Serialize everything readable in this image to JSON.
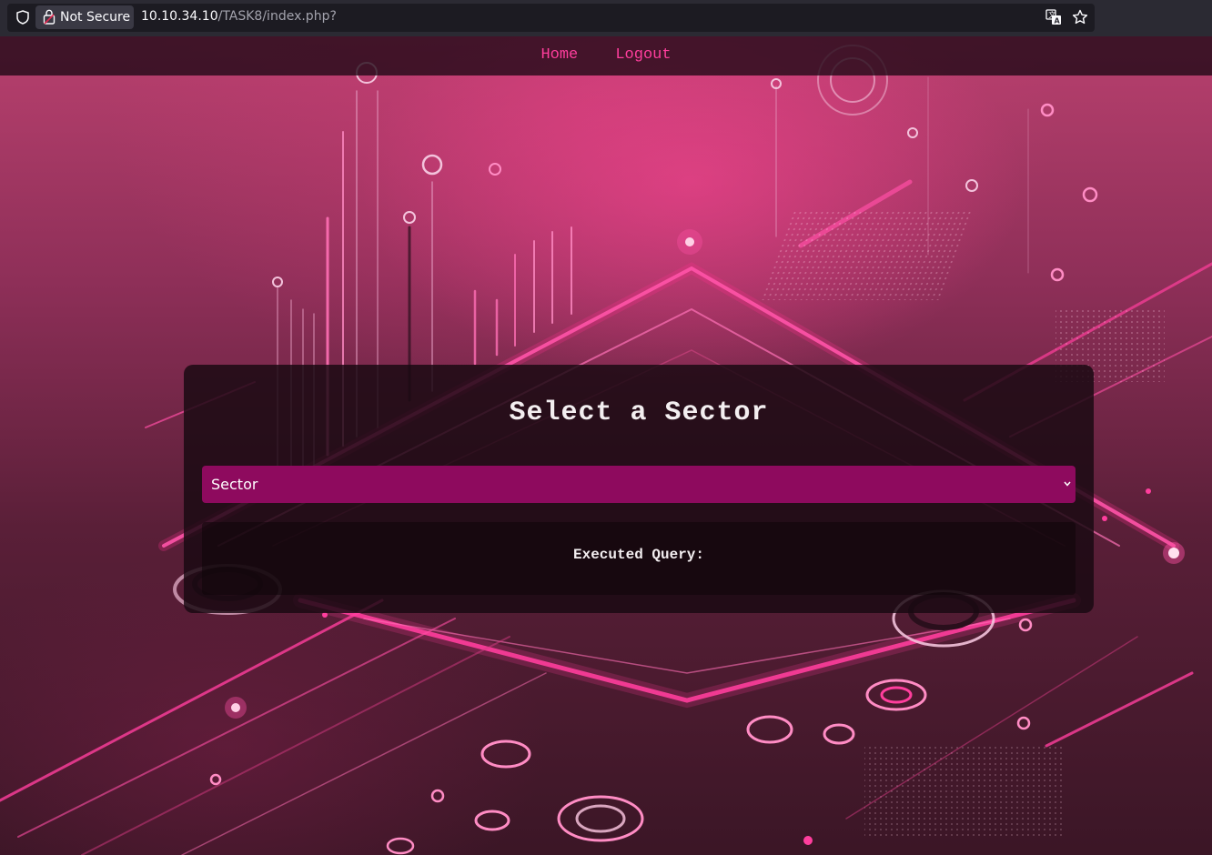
{
  "browser": {
    "security_label": "Not Secure",
    "url_host": "10.10.34.10",
    "url_path": "/TASK8/index.php?"
  },
  "nav": {
    "items": [
      {
        "label": "Home"
      },
      {
        "label": "Logout"
      }
    ]
  },
  "panel": {
    "title": "Select a Sector",
    "select": {
      "selected_value": "Sector"
    },
    "query_label": "Executed Query:"
  },
  "colors": {
    "accent": "#ff3e9d",
    "select_bg": "#8e0a5e",
    "panel_bg": "#190a12"
  }
}
